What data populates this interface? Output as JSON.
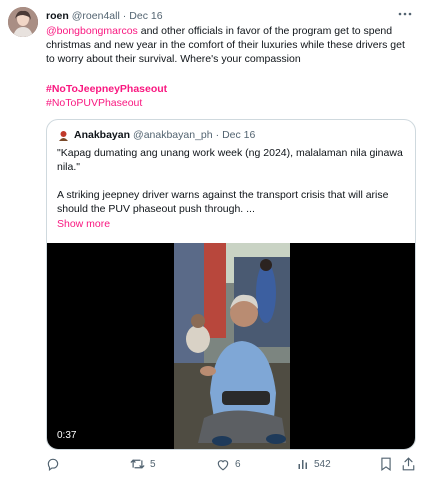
{
  "tweet": {
    "author_name": "roen",
    "author_handle": "@roen4all",
    "separator": "·",
    "date": "Dec 16",
    "mention": "@bongbongmarcos",
    "text_after_mention": " and other officials in favor of the program get to spend christmas and new year in the comfort of their luxuries while these drivers get to worry about their survival. Where's your compassion",
    "hashtags": [
      "#NoToJeepneyPhaseout",
      "#NoToPUVPhaseout"
    ]
  },
  "quoted_tweet": {
    "author_name": "Anakbayan",
    "author_handle": "@anakbayan_ph",
    "separator": "·",
    "date": "Dec 16",
    "quote_line": "\"Kapag dumating ang unang work week (ng 2024), malalaman nila ginawa nila.\"",
    "description": "A striking jeepney driver warns against the transport crisis that will arise should the PUV phaseout push through. ...",
    "show_more": "Show more",
    "video_duration": "0:37"
  },
  "actions": {
    "reply_count": "",
    "retweet_count": "5",
    "like_count": "6",
    "view_count": "542"
  },
  "colors": {
    "accent": "#f91880",
    "text": "#0f1419",
    "muted": "#536471",
    "border": "#cfd9de"
  },
  "icons": [
    "more-icon",
    "reply-icon",
    "retweet-icon",
    "like-icon",
    "views-icon",
    "bookmark-icon",
    "share-icon"
  ]
}
